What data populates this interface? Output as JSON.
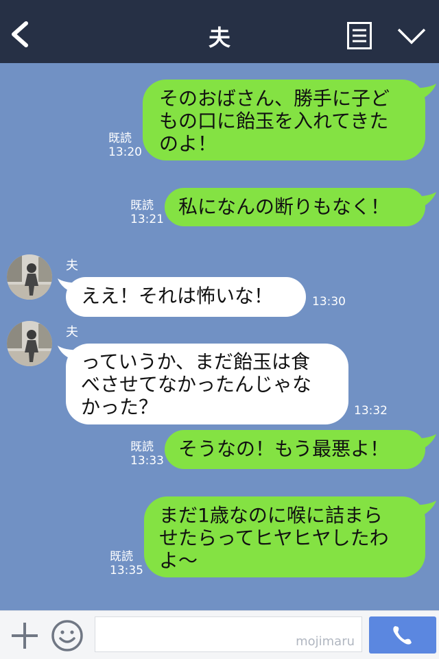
{
  "header": {
    "title": "夫"
  },
  "messages": [
    {
      "type": "sent",
      "text": "そのおばさん、勝手に子ど\nもの口に飴玉を入れてきた\nのよ！",
      "read": "既読",
      "time": "13:20"
    },
    {
      "type": "sent",
      "text": "私になんの断りもなく！",
      "read": "既読",
      "time": "13:21"
    },
    {
      "type": "received",
      "sender": "夫",
      "text": "ええ！それは怖いな！",
      "time": "13:30"
    },
    {
      "type": "received",
      "sender": "夫",
      "text": "っていうか、まだ飴玉は食\nべさせてなかったんじゃな\nかった？",
      "time": "13:32"
    },
    {
      "type": "sent",
      "text": "そうなの！もう最悪よ！",
      "read": "既読",
      "time": "13:33"
    },
    {
      "type": "sent",
      "text": "まだ1歳なのに喉に詰まら\nせたらってヒヤヒヤしたわ\nよ〜",
      "read": "既読",
      "time": "13:35"
    }
  ],
  "input": {
    "watermark": "mojimaru"
  },
  "colors": {
    "header": "#263045",
    "background": "#7191c4",
    "sent_bubble": "#84e243",
    "received_bubble": "#ffffff",
    "call_button": "#5b87e0"
  },
  "icons": [
    "back-arrow-icon",
    "menu-list-icon",
    "chevron-down-icon",
    "plus-icon",
    "smiley-icon",
    "phone-icon"
  ]
}
